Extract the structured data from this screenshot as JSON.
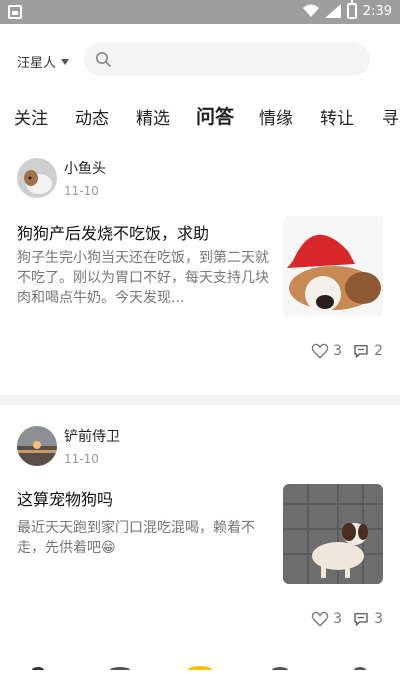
{
  "status_bar": {
    "time": "2:39"
  },
  "header": {
    "city": "汪星人",
    "search_placeholder": ""
  },
  "tabs": [
    {
      "label": "关注"
    },
    {
      "label": "动态"
    },
    {
      "label": "精选"
    },
    {
      "label": "问答",
      "active": true
    },
    {
      "label": "情缘"
    },
    {
      "label": "转让"
    },
    {
      "label": "寻"
    }
  ],
  "posts": [
    {
      "author": "小鱼头",
      "date": "11-10",
      "title": "狗狗产后发烧不吃饭，求助",
      "body": "狗子生完小狗当天还在吃饭，到第二天就不吃了。刚以为胃口不好，每天支持几块肉和喝点牛奶。今天发现...",
      "likes": "3",
      "comments": "2"
    },
    {
      "author": "铲前侍卫",
      "date": "11-10",
      "title": "这算宠物狗吗",
      "body": "最近天天跑到家门口混吃混喝，赖着不走，先供着吧😁",
      "likes": "3",
      "comments": "3"
    }
  ],
  "colors": {
    "accent": "#222222",
    "muted": "#999999"
  }
}
